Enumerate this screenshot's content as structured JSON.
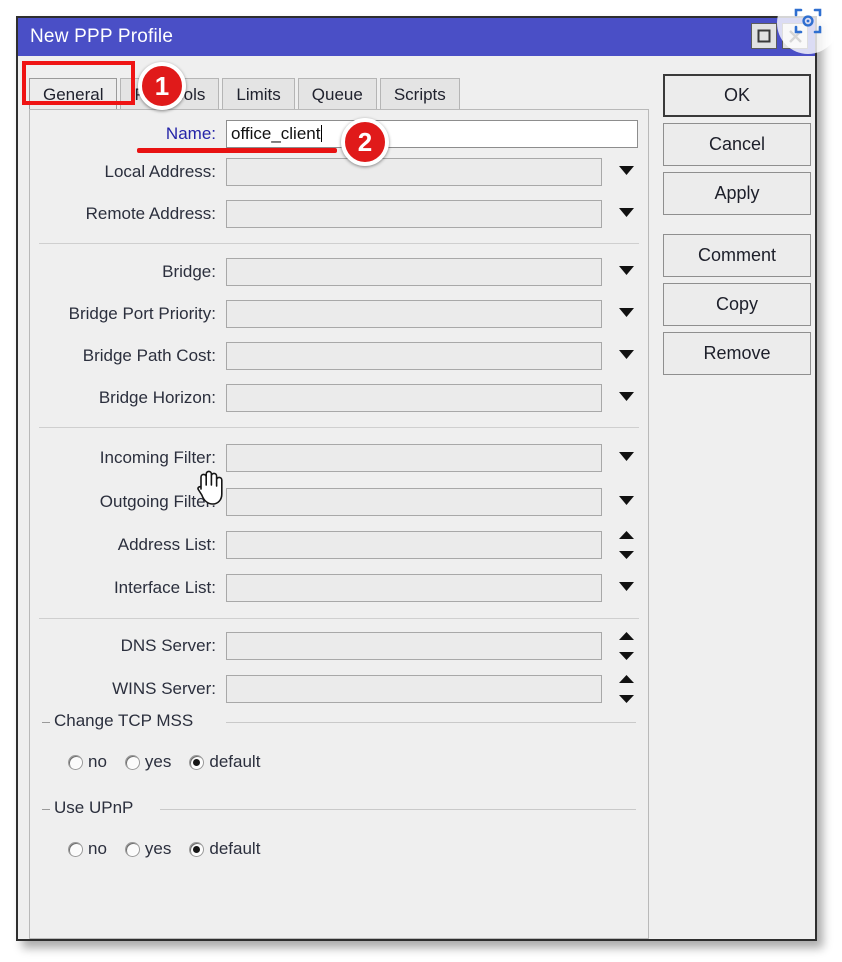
{
  "window": {
    "title": "New PPP Profile",
    "controls": [
      {
        "name": "maximize",
        "glyph": "maximize-icon"
      },
      {
        "name": "close",
        "glyph": "close-icon"
      }
    ]
  },
  "tabs": [
    {
      "label": "General",
      "active": true
    },
    {
      "label": "Protocols",
      "active": false
    },
    {
      "label": "Limits",
      "active": false
    },
    {
      "label": "Queue",
      "active": false
    },
    {
      "label": "Scripts",
      "active": false
    }
  ],
  "form": {
    "name_label": "Name:",
    "name_value": "office_client",
    "rows": [
      {
        "label": "Local Address:",
        "value": "",
        "control": "dropdown"
      },
      {
        "label": "Remote Address:",
        "value": "",
        "control": "dropdown"
      },
      {
        "label": "Bridge:",
        "value": "",
        "control": "dropdown"
      },
      {
        "label": "Bridge Port Priority:",
        "value": "",
        "control": "dropdown"
      },
      {
        "label": "Bridge Path Cost:",
        "value": "",
        "control": "dropdown"
      },
      {
        "label": "Bridge Horizon:",
        "value": "",
        "control": "dropdown"
      },
      {
        "label": "Incoming Filter:",
        "value": "",
        "control": "dropdown"
      },
      {
        "label": "Outgoing Filter:",
        "value": "",
        "control": "dropdown"
      },
      {
        "label": "Address List:",
        "value": "",
        "control": "spinner"
      },
      {
        "label": "Interface List:",
        "value": "",
        "control": "dropdown"
      },
      {
        "label": "DNS Server:",
        "value": "",
        "control": "spinner"
      },
      {
        "label": "WINS Server:",
        "value": "",
        "control": "spinner"
      }
    ],
    "groups": [
      {
        "title": "Change TCP MSS",
        "options": [
          {
            "label": "no",
            "selected": false
          },
          {
            "label": "yes",
            "selected": false
          },
          {
            "label": "default",
            "selected": true
          }
        ]
      },
      {
        "title": "Use UPnP",
        "options": [
          {
            "label": "no",
            "selected": false
          },
          {
            "label": "yes",
            "selected": false
          },
          {
            "label": "default",
            "selected": true
          }
        ]
      }
    ]
  },
  "buttons": [
    {
      "label": "OK",
      "focus": true
    },
    {
      "label": "Cancel",
      "focus": false
    },
    {
      "label": "Apply",
      "focus": false
    },
    {
      "label": "Comment",
      "focus": false
    },
    {
      "label": "Copy",
      "focus": false
    },
    {
      "label": "Remove",
      "focus": false
    }
  ],
  "annotations": {
    "badge_1": "1",
    "badge_2": "2"
  },
  "colors": {
    "titlebar": "#4a4fc6",
    "annotation_red": "#e01a1a",
    "dialog_bg": "#efefef",
    "label_text": "#2b2f3d",
    "watermark_blue": "#2f6fd0"
  }
}
